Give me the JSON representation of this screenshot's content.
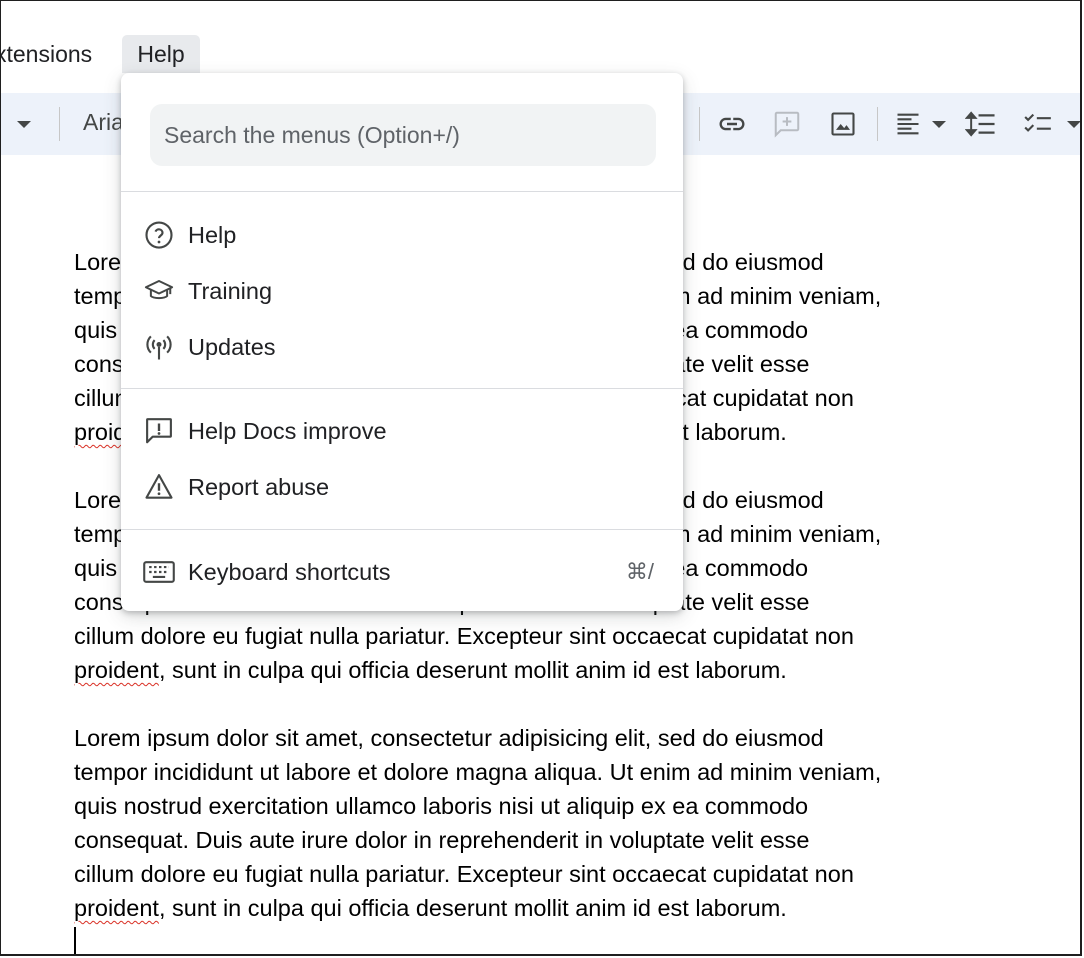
{
  "menubar": {
    "extensions_label": "xtensions",
    "help_label": "Help"
  },
  "toolbar": {
    "font_name": "Aria",
    "icons": [
      "insert-link-icon",
      "add-comment-icon",
      "insert-image-icon",
      "align-left-icon",
      "line-spacing-icon",
      "checklist-icon"
    ]
  },
  "help_menu": {
    "search_placeholder": "Search the menus (Option+/)",
    "items": [
      {
        "label": "Help",
        "icon": "help-circle-icon"
      },
      {
        "label": "Training",
        "icon": "graduation-cap-icon"
      },
      {
        "label": "Updates",
        "icon": "broadcast-icon"
      },
      {
        "label": "Help Docs improve",
        "icon": "feedback-icon"
      },
      {
        "label": "Report abuse",
        "icon": "warning-triangle-icon"
      },
      {
        "label": "Keyboard shortcuts",
        "icon": "keyboard-icon",
        "shortcut": "⌘/"
      }
    ]
  },
  "document": {
    "paragraphs": [
      {
        "text_before": "Lorem ipsum dolor sit amet, consectetur adipisicing elit, sed do eiusmod\ntempor incididunt ut labore et dolore magna aliqua. Ut enim ad minim veniam,\nquis nostrud exercitation ullamco laboris nisi ut aliquip ex ea commodo\nconsequat. Duis aute irure dolor in reprehenderit in voluptate velit esse\ncillum dolore eu fugiat nulla pariatur. Excepteur sint occaecat cupidatat non\n",
        "misspelled": "proident",
        "text_after": ", sunt in culpa qui officia deserunt mollit anim id est laborum."
      },
      {
        "text_before": "Lorem ipsum dolor sit amet, consectetur adipisicing elit, sed do eiusmod\ntempor incididunt ut labore et dolore magna aliqua. Ut enim ad minim veniam,\nquis nostrud exercitation ullamco laboris nisi ut aliquip ex ea commodo\nconsequat. Duis aute irure dolor in reprehenderit in voluptate velit esse\ncillum dolore eu fugiat nulla pariatur. Excepteur sint occaecat cupidatat non\n",
        "misspelled": "proident",
        "text_after": ", sunt in culpa qui officia deserunt mollit anim id est laborum."
      },
      {
        "text_before": "Lorem ipsum dolor sit amet, consectetur adipisicing elit, sed do eiusmod\ntempor incididunt ut labore et dolore magna aliqua. Ut enim ad minim veniam,\nquis nostrud exercitation ullamco laboris nisi ut aliquip ex ea commodo\nconsequat. Duis aute irure dolor in reprehenderit in voluptate velit esse\ncillum dolore eu fugiat nulla pariatur. Excepteur sint occaecat cupidatat non\n",
        "misspelled": "proident",
        "text_after": ", sunt in culpa qui officia deserunt mollit anim id est laborum."
      }
    ]
  },
  "colors": {
    "toolbar_bg": "#edf2fa",
    "menu_active_bg": "#e8eaed",
    "spellcheck_underline": "#d93025"
  }
}
